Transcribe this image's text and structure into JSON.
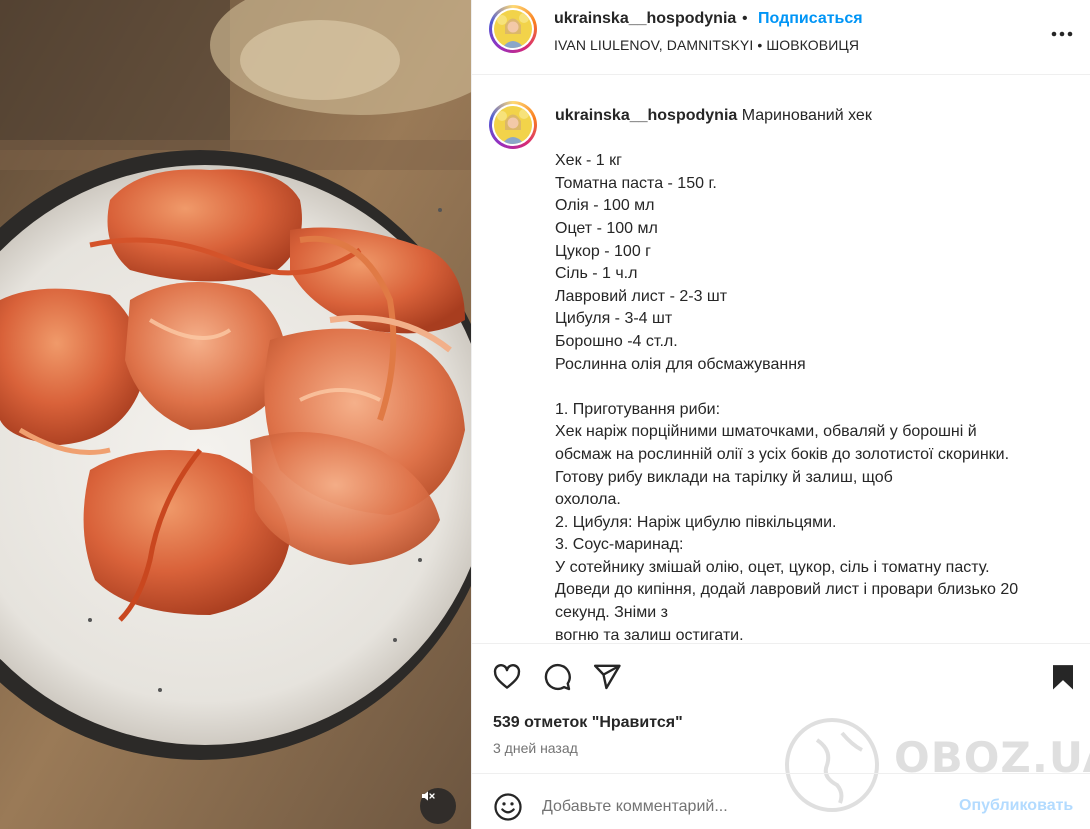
{
  "post": {
    "username": "ukrainska__hospodynia",
    "separator": "•",
    "follow_label": "Подписаться",
    "audio_line": "IVAN LIULENOV, DAMNITSKYI • ШОВКОВИЦЯ",
    "more_icon": "more-horizontal-icon"
  },
  "caption": {
    "username": "ukrainska__hospodynia",
    "title": "Маринований хек",
    "lines": [
      "",
      "Хек - 1 кг",
      "Томатна паста - 150 г.",
      "Олія - 100 мл",
      "Оцет - 100 мл",
      "Цукор - 100 г",
      "Сіль - 1 ч.л",
      "Лавровий лист - 2-3 шт",
      "Цибуля - 3-4 шт",
      "Борошно -4 ст.л.",
      "Рослинна олія для обсмажування",
      "",
      "1. Приготування риби:",
      "Хек наріж порційними шматочками, обваляй у борошні й",
      "обсмаж на рослинній олії з усіх боків до золотистої скоринки.",
      "Готову рибу виклади на тарілку й залиш, щоб",
      "охолола.",
      "2. Цибуля: Наріж цибулю півкільцями.",
      "3. Соус-маринад:",
      "У сотейнику змішай олію, оцет, цукор, сіль і томатну пасту.",
      "Доведи до кипіння, додай лавровий лист і провари близько 20",
      "секунд. Зніми з",
      "вогню та залиш остигати."
    ]
  },
  "actions": {
    "icons": [
      "heart-icon",
      "comment-icon",
      "share-icon",
      "bookmark-icon"
    ],
    "likes": "539 отметок \"Нравится\"",
    "time_ago": "3 дней назад"
  },
  "comment": {
    "placeholder": "Добавьте комментарий...",
    "publish_label": "Опубликовать"
  },
  "media": {
    "mute_icon": "volume-muted-icon"
  },
  "watermark": {
    "text": "OBOZ.UA"
  },
  "colors": {
    "accent": "#0095f6",
    "publish_disabled": "#b3dbff",
    "secondary_text": "#737373",
    "border": "#efefef"
  }
}
